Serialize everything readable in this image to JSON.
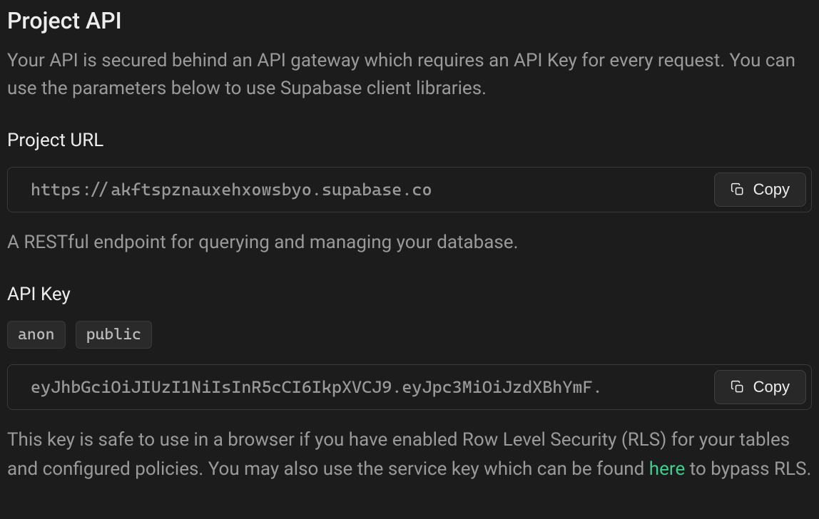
{
  "header": {
    "title": "Project API",
    "description": "Your API is secured behind an API gateway which requires an API Key for every request. You can use the parameters below to use Supabase client libraries."
  },
  "project_url": {
    "label": "Project URL",
    "value": "https://akftspznauxehxowsbyo.supabase.co",
    "help": "A RESTful endpoint for querying and managing your database.",
    "copy_label": "Copy"
  },
  "api_key": {
    "label": "API Key",
    "tags": [
      "anon",
      "public"
    ],
    "value": "eyJhbGciOiJIUzI1NiIsInR5cCI6IkpXVCJ9.eyJpc3MiOiJzdXBhYmF.",
    "copy_label": "Copy",
    "help_prefix": "This key is safe to use in a browser if you have enabled Row Level Security (RLS) for your tables and configured policies. You may also use the service key which can be found ",
    "help_link": "here",
    "help_suffix": " to bypass RLS."
  }
}
